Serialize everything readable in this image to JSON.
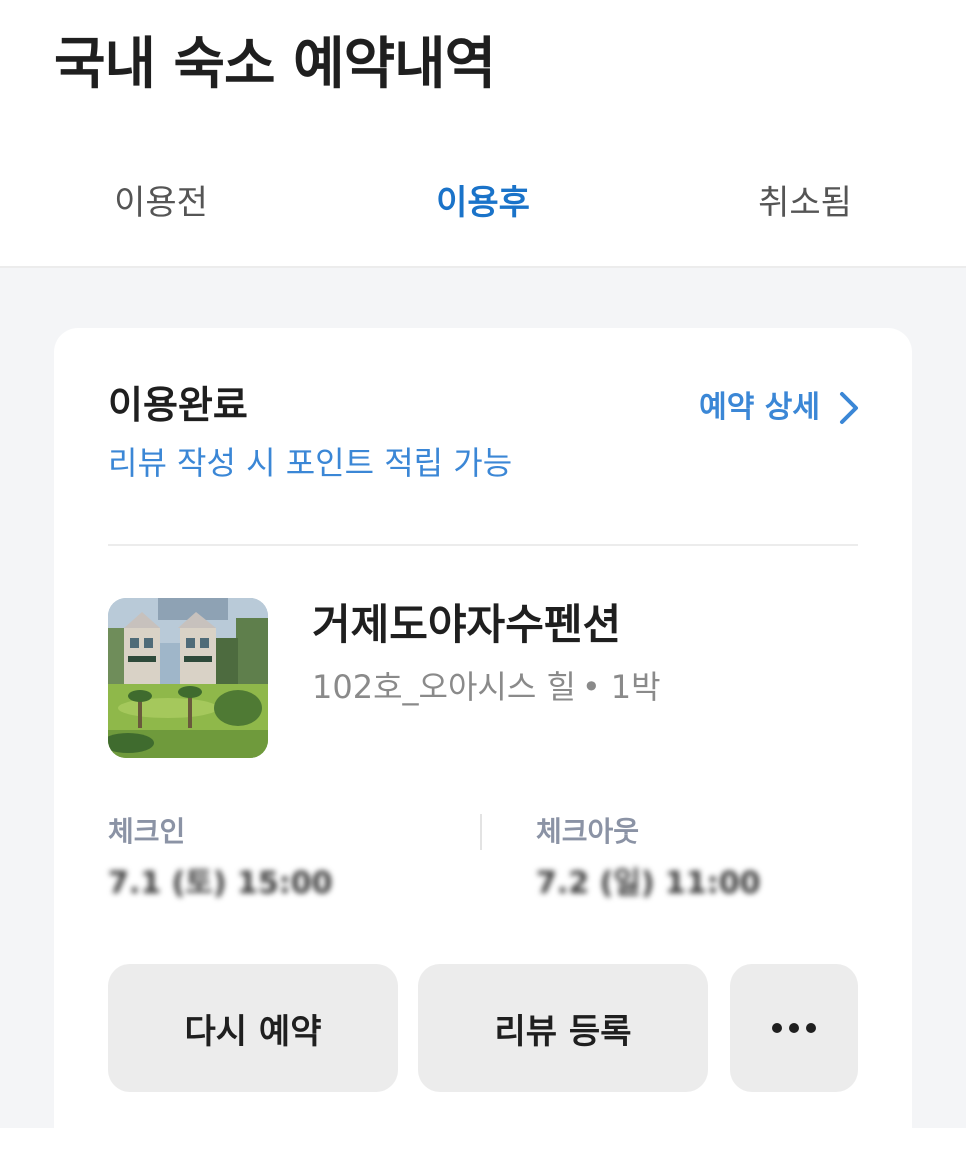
{
  "header": {
    "title": "국내 숙소 예약내역"
  },
  "tabs": [
    {
      "label": "이용전",
      "active": false
    },
    {
      "label": "이용후",
      "active": true
    },
    {
      "label": "취소됨",
      "active": false
    }
  ],
  "booking": {
    "status_title": "이용완료",
    "status_sub": "리뷰 작성 시 포인트 적립 가능",
    "detail_link": "예약 상세",
    "hotel_name": "거제도야자수펜션",
    "room": "102호_오아시스 힐",
    "separator": "•",
    "nights": "1박",
    "check_in_label": "체크인",
    "check_in_value": "7.1 (토) 15:00",
    "check_out_label": "체크아웃",
    "check_out_value": "7.2 (일) 11:00",
    "buttons": {
      "rebook": "다시 예약",
      "review": "리뷰 등록"
    }
  },
  "colors": {
    "accent": "#1a73c9",
    "link": "#3b87d6",
    "button_bg": "#ececec",
    "page_bg": "#f4f5f7"
  },
  "icons": {
    "detail_chevron": "chevron-right-icon",
    "more": "more-horizontal-icon"
  }
}
